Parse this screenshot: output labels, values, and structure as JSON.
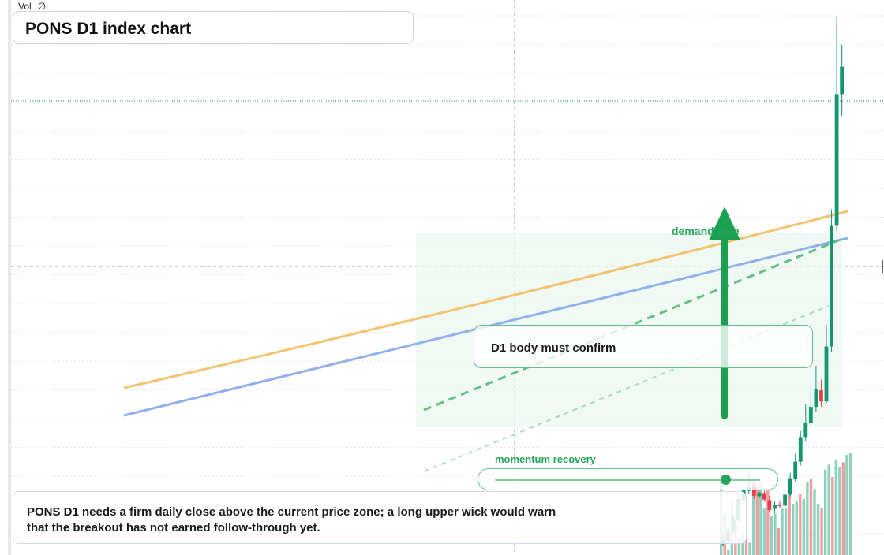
{
  "header": {
    "vol_label": "Vol",
    "vol_value": "∅"
  },
  "title": "PONS D1 index chart",
  "annotations": {
    "demand_label": "demand side",
    "confirm_label": "D1 body must confirm",
    "momentum_label": "momentum recovery",
    "momentum_level": 0.87,
    "note": "PONS D1 needs a firm daily close above the current price zone; a long upper wick would warn that the breakout has not earned follow-through yet."
  },
  "colors": {
    "up": "#14966e",
    "down": "#e5404a",
    "vol_up": "#8fd1bf",
    "vol_down": "#f29c9f",
    "ma_orange": "#f3c36d",
    "ma_blue": "#8fb0ea",
    "accent_green": "#1aa04f"
  },
  "chart_data": {
    "type": "candlestick",
    "title": "PONS D1 index chart",
    "xlabel": "",
    "ylabel": "",
    "grid": true,
    "ylim": [
      0,
      100
    ],
    "xlim": [
      0,
      60
    ],
    "candles": [
      {
        "x": 50,
        "o": 2.0,
        "c": 2.8,
        "h": 3.4,
        "l": 1.6
      },
      {
        "x": 51,
        "o": 2.6,
        "c": 4.4,
        "h": 5.0,
        "l": 2.2
      },
      {
        "x": 52,
        "o": 4.2,
        "c": 6.6,
        "h": 7.2,
        "l": 3.8
      },
      {
        "x": 53,
        "o": 6.4,
        "c": 10.2,
        "h": 11.0,
        "l": 6.0
      },
      {
        "x": 54,
        "o": 10.0,
        "c": 11.9,
        "h": 12.4,
        "l": 9.0
      },
      {
        "x": 55,
        "o": 11.7,
        "c": 12.3,
        "h": 15.0,
        "l": 11.2
      },
      {
        "x": 56,
        "o": 12.5,
        "c": 10.8,
        "h": 13.2,
        "l": 10.2
      },
      {
        "x": 57,
        "o": 10.7,
        "c": 11.4,
        "h": 12.0,
        "l": 10.2
      },
      {
        "x": 58,
        "o": 11.3,
        "c": 10.1,
        "h": 12.3,
        "l": 9.7
      },
      {
        "x": 59,
        "o": 10.0,
        "c": 8.2,
        "h": 10.8,
        "l": 7.8
      },
      {
        "x": 60,
        "o": 8.4,
        "c": 9.2,
        "h": 9.8,
        "l": 7.6
      },
      {
        "x": 61,
        "o": 9.2,
        "c": 8.9,
        "h": 9.9,
        "l": 8.5
      },
      {
        "x": 62,
        "o": 9.0,
        "c": 11.0,
        "h": 11.6,
        "l": 8.6
      },
      {
        "x": 63,
        "o": 11.0,
        "c": 14.0,
        "h": 15.0,
        "l": 10.5
      },
      {
        "x": 64,
        "o": 13.9,
        "c": 17.0,
        "h": 18.5,
        "l": 13.4
      },
      {
        "x": 65,
        "o": 17.0,
        "c": 21.5,
        "h": 22.6,
        "l": 16.3
      },
      {
        "x": 66,
        "o": 21.5,
        "c": 24.0,
        "h": 27.5,
        "l": 20.8
      },
      {
        "x": 67,
        "o": 24.0,
        "c": 27.0,
        "h": 31.0,
        "l": 23.5
      },
      {
        "x": 68,
        "o": 27.0,
        "c": 30.2,
        "h": 34.5,
        "l": 26.0
      },
      {
        "x": 69,
        "o": 30.0,
        "c": 28.0,
        "h": 32.0,
        "l": 27.0
      },
      {
        "x": 70,
        "o": 28.0,
        "c": 38.0,
        "h": 42.0,
        "l": 27.5
      },
      {
        "x": 71,
        "o": 38.0,
        "c": 60.0,
        "h": 63.0,
        "l": 37.0
      },
      {
        "x": 72,
        "o": 60.0,
        "c": 84.0,
        "h": 98.0,
        "l": 59.0
      },
      {
        "x": 73,
        "o": 84.0,
        "c": 89.0,
        "h": 93.0,
        "l": 80.0
      }
    ],
    "volume": [
      34,
      17,
      2,
      22,
      12,
      7,
      9,
      7,
      5,
      30,
      28,
      29,
      19,
      27,
      16,
      17,
      11,
      19,
      19,
      25,
      21,
      22,
      25,
      23,
      30,
      31,
      27,
      21,
      19,
      35,
      37,
      32,
      39,
      36,
      38,
      41,
      42
    ]
  }
}
